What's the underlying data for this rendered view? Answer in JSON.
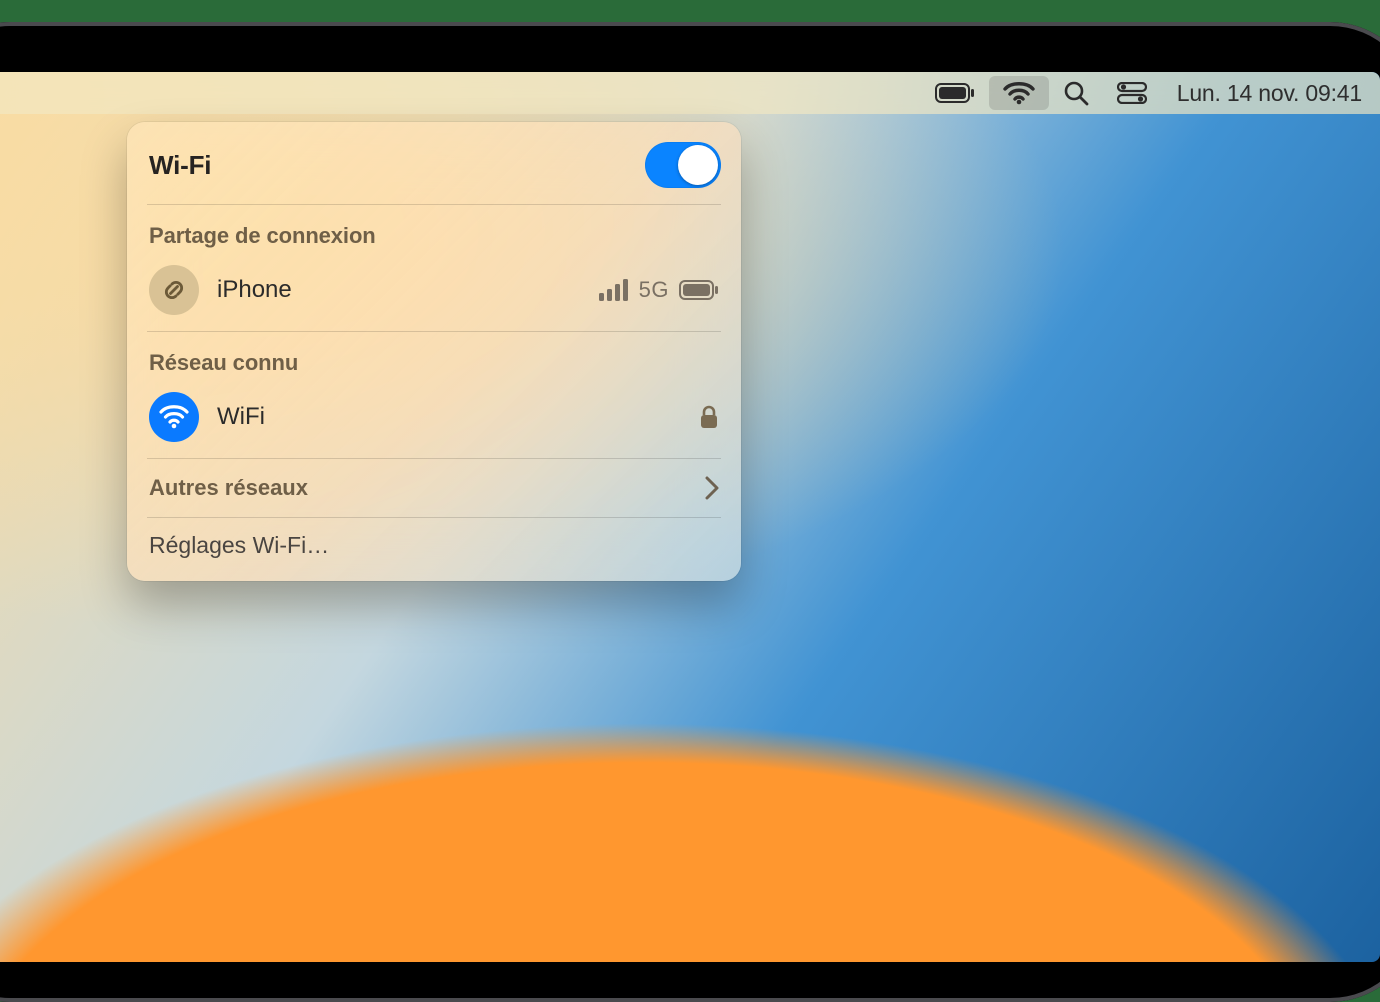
{
  "menubar": {
    "clock": "Lun. 14 nov. 09:41"
  },
  "panel": {
    "title": "Wi-Fi",
    "wifi_on": true,
    "hotspot_section": "Partage de connexion",
    "hotspot": {
      "name": "iPhone",
      "cell_label": "5G"
    },
    "known_section": "Réseau connu",
    "known_network": {
      "name": "WiFi",
      "secured": true
    },
    "other_networks": "Autres réseaux",
    "settings": "Réglages Wi-Fi…"
  }
}
